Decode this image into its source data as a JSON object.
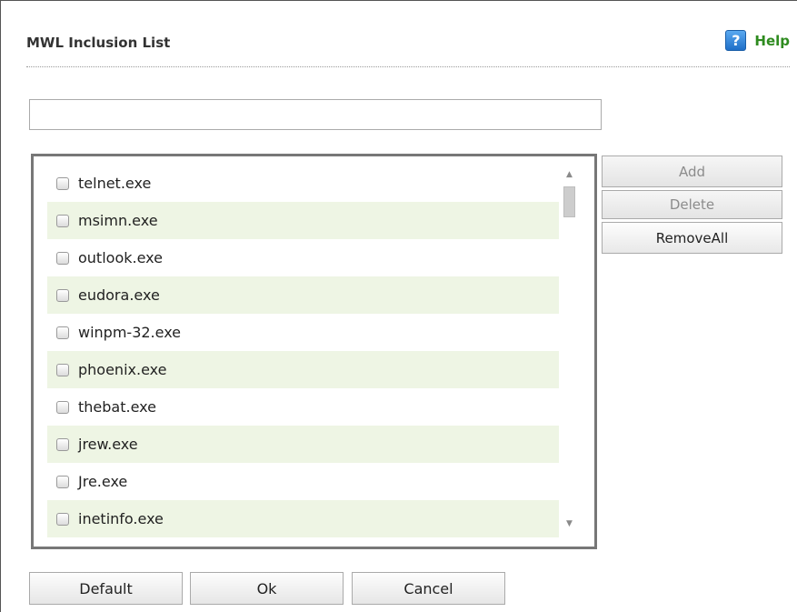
{
  "header": {
    "title": "MWL Inclusion List",
    "help_icon_text": "?",
    "help_label": "Help"
  },
  "input": {
    "value": ""
  },
  "list": {
    "items": [
      {
        "label": "telnet.exe",
        "checked": false
      },
      {
        "label": "msimn.exe",
        "checked": false
      },
      {
        "label": "outlook.exe",
        "checked": false
      },
      {
        "label": "eudora.exe",
        "checked": false
      },
      {
        "label": "winpm-32.exe",
        "checked": false
      },
      {
        "label": "phoenix.exe",
        "checked": false
      },
      {
        "label": "thebat.exe",
        "checked": false
      },
      {
        "label": "jrew.exe",
        "checked": false
      },
      {
        "label": "Jre.exe",
        "checked": false
      },
      {
        "label": "inetinfo.exe",
        "checked": false
      }
    ],
    "scroll_up_glyph": "▲",
    "scroll_down_glyph": "▼"
  },
  "side_buttons": {
    "add": "Add",
    "delete": "Delete",
    "remove_all": "RemoveAll"
  },
  "footer_buttons": {
    "default": "Default",
    "ok": "Ok",
    "cancel": "Cancel"
  },
  "colors": {
    "help_green": "#2e8b1f",
    "alt_row": "#eef5e4",
    "help_icon_blue": "#1f6fc8"
  }
}
